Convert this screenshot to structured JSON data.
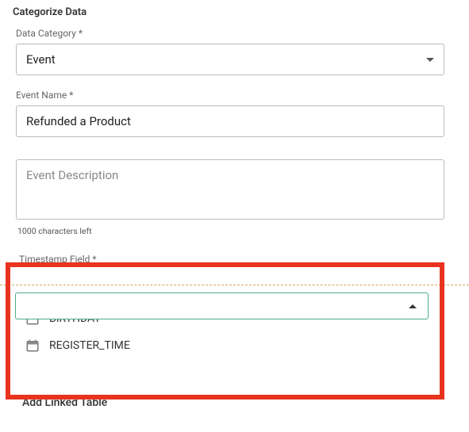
{
  "section": {
    "title": "Categorize Data"
  },
  "dataCategory": {
    "label": "Data Category *",
    "value": "Event"
  },
  "eventName": {
    "label": "Event Name *",
    "value": "Refunded a Product"
  },
  "eventDescription": {
    "placeholder": "Event Description",
    "helper": "1000 characters left"
  },
  "timestampField": {
    "label": "Timestamp Field *",
    "options": [
      {
        "label": "BIRTHDAY"
      },
      {
        "label": "REGISTER_TIME"
      }
    ]
  },
  "addLinked": {
    "label": "Add Linked Table"
  }
}
